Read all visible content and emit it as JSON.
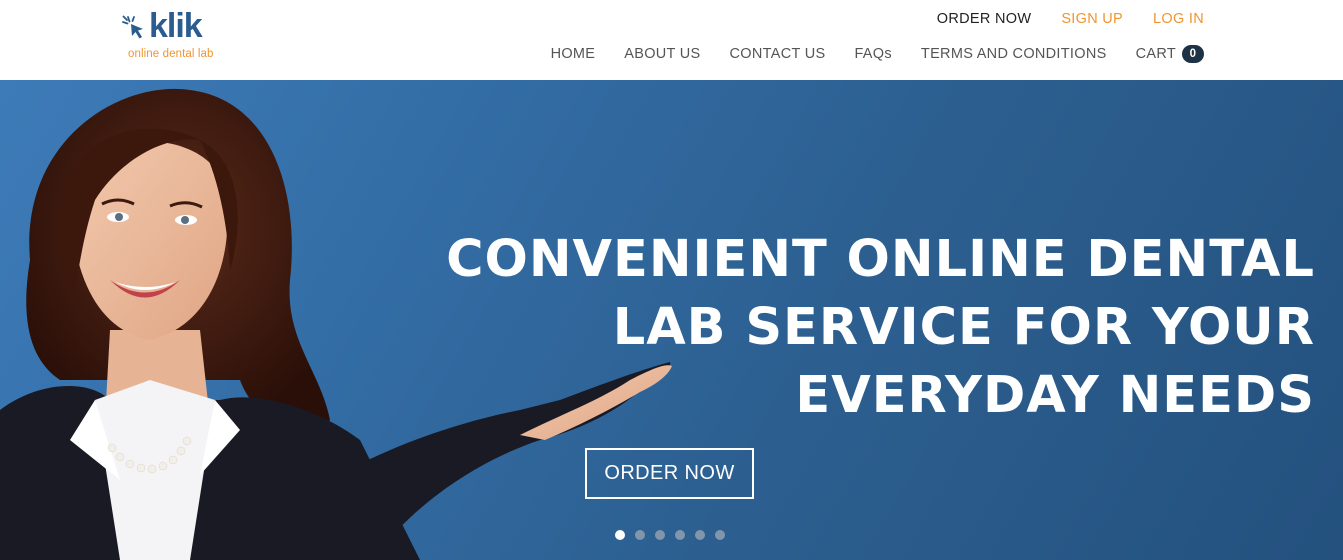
{
  "brand": {
    "name": "klik",
    "tagline": "online dental lab"
  },
  "topnav": {
    "order_now": "ORDER NOW",
    "sign_up": "SIGN UP",
    "log_in": "LOG IN"
  },
  "mainnav": {
    "items": [
      "HOME",
      "ABOUT US",
      "CONTACT US",
      "FAQs",
      "TERMS AND CONDITIONS",
      "CART"
    ],
    "cart_count": "0"
  },
  "hero": {
    "headline_lines": [
      "CONVENIENT ONLINE DENTAL",
      "LAB SERVICE FOR YOUR",
      "EVERYDAY NEEDS"
    ],
    "button_label": "ORDER NOW",
    "slide_count": 6,
    "active_slide": 1
  },
  "colors": {
    "brand_blue": "#2a5c8f",
    "accent_orange": "#f0952f",
    "hero_blue": "#336da5",
    "badge_dark": "#1e3246"
  }
}
